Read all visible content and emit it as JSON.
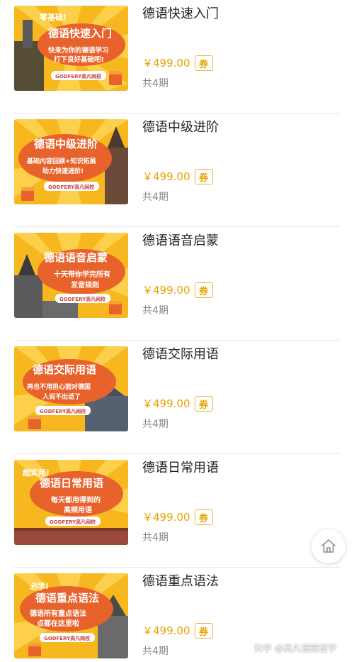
{
  "courses": [
    {
      "title": "德语快速入门",
      "price": "￥499.00",
      "coupon": "券",
      "periods": "共4期",
      "banner": {
        "tag": "零基础!",
        "headline": "德语快速入门",
        "lines": [
          "快来为你的德语学习",
          "打下良好基础吧!"
        ],
        "brand": "GODFERY高凡网校"
      }
    },
    {
      "title": "德语中级进阶",
      "price": "￥499.00",
      "coupon": "券",
      "periods": "共4期",
      "banner": {
        "tag": "",
        "headline": "德语中级进阶",
        "lines": [
          "基础内容回顾+知识拓展",
          "助力快速进阶!"
        ],
        "brand": "GODFERY高凡网校"
      }
    },
    {
      "title": "德语语音启蒙",
      "price": "￥499.00",
      "coupon": "券",
      "periods": "共4期",
      "banner": {
        "tag": "",
        "headline": "德语语音启蒙",
        "lines": [
          "十天带你学完所有",
          "发音规则"
        ],
        "brand": "GODFERY高凡网校"
      }
    },
    {
      "title": "德语交际用语",
      "price": "￥499.00",
      "coupon": "券",
      "periods": "共4期",
      "banner": {
        "tag": "",
        "headline": "德语交际用语",
        "lines": [
          "再也不用担心面对德国",
          "人说不出话了"
        ],
        "brand": "GODFERY高凡网校"
      }
    },
    {
      "title": "德语日常用语",
      "price": "￥499.00",
      "coupon": "券",
      "periods": "共4期",
      "banner": {
        "tag": "超实用!",
        "headline": "德语日常用语",
        "lines": [
          "每天都用得到的",
          "高频用语"
        ],
        "brand": "GODFERY高凡网校"
      }
    },
    {
      "title": "德语重点语法",
      "price": "￥499.00",
      "coupon": "券",
      "periods": "共4期",
      "banner": {
        "tag": "必学!",
        "headline": "德语重点语法",
        "lines": [
          "德语所有重点语法",
          "点都在这里啦"
        ],
        "brand": "GODFERY高凡网校"
      }
    }
  ],
  "floating": {
    "icon": "home-icon"
  },
  "watermark": "知乎 @高凡德国留学",
  "colors": {
    "price": "#e8a200",
    "banner_bg": "#f7b81f",
    "banner_cloud": "#e8622c"
  }
}
